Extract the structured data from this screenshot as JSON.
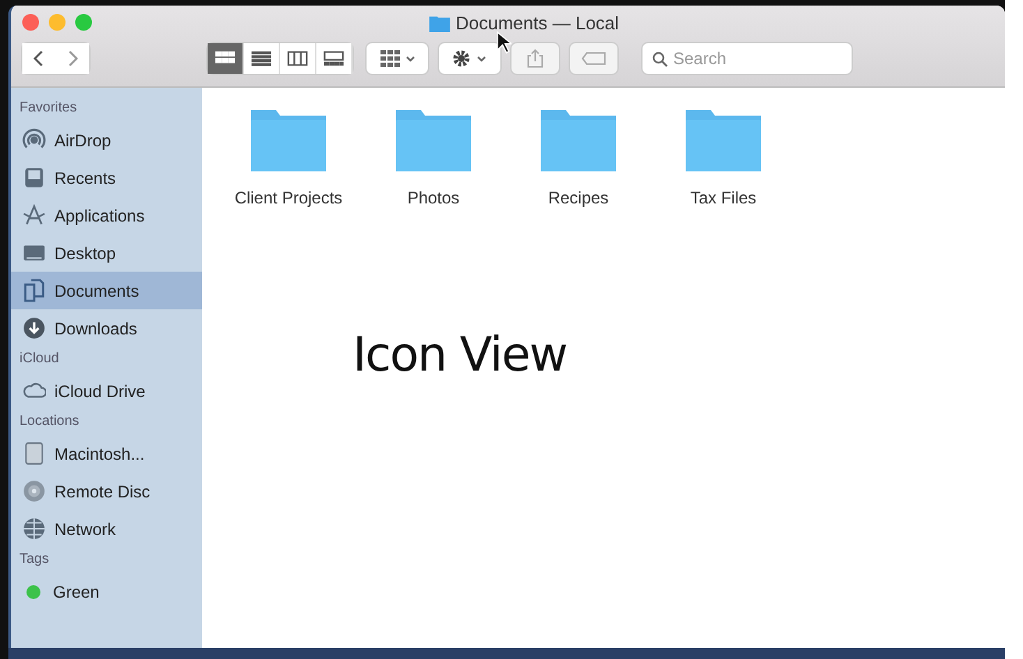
{
  "window": {
    "title": "Documents — Local"
  },
  "toolbar": {
    "view_modes": [
      {
        "kind": "icons",
        "selected": true
      },
      {
        "kind": "list",
        "selected": false
      },
      {
        "kind": "columns",
        "selected": false
      },
      {
        "kind": "gallery",
        "selected": false
      }
    ],
    "search": {
      "placeholder": "Search"
    }
  },
  "sidebar": {
    "sections": [
      {
        "title": "Favorites",
        "items": [
          {
            "kind": "airdrop",
            "label": "AirDrop",
            "selected": false
          },
          {
            "kind": "recents",
            "label": "Recents",
            "selected": false
          },
          {
            "kind": "apps",
            "label": "Applications",
            "selected": false
          },
          {
            "kind": "desktop",
            "label": "Desktop",
            "selected": false
          },
          {
            "kind": "documents",
            "label": "Documents",
            "selected": true
          },
          {
            "kind": "downloads",
            "label": "Downloads",
            "selected": false
          }
        ]
      },
      {
        "title": "iCloud",
        "items": [
          {
            "kind": "cloud",
            "label": "iCloud Drive",
            "selected": false
          }
        ]
      },
      {
        "title": "Locations",
        "items": [
          {
            "kind": "disk",
            "label": "Macintosh...",
            "selected": false
          },
          {
            "kind": "disc",
            "label": "Remote Disc",
            "selected": false
          },
          {
            "kind": "network",
            "label": "Network",
            "selected": false
          }
        ]
      },
      {
        "title": "Tags",
        "items": [
          {
            "kind": "tag",
            "label": "Green",
            "color": "#3cc24a",
            "selected": false
          }
        ]
      }
    ]
  },
  "folders": [
    {
      "name": "Client Projects"
    },
    {
      "name": "Photos"
    },
    {
      "name": "Recipes"
    },
    {
      "name": "Tax Files"
    }
  ],
  "caption": "Icon View"
}
